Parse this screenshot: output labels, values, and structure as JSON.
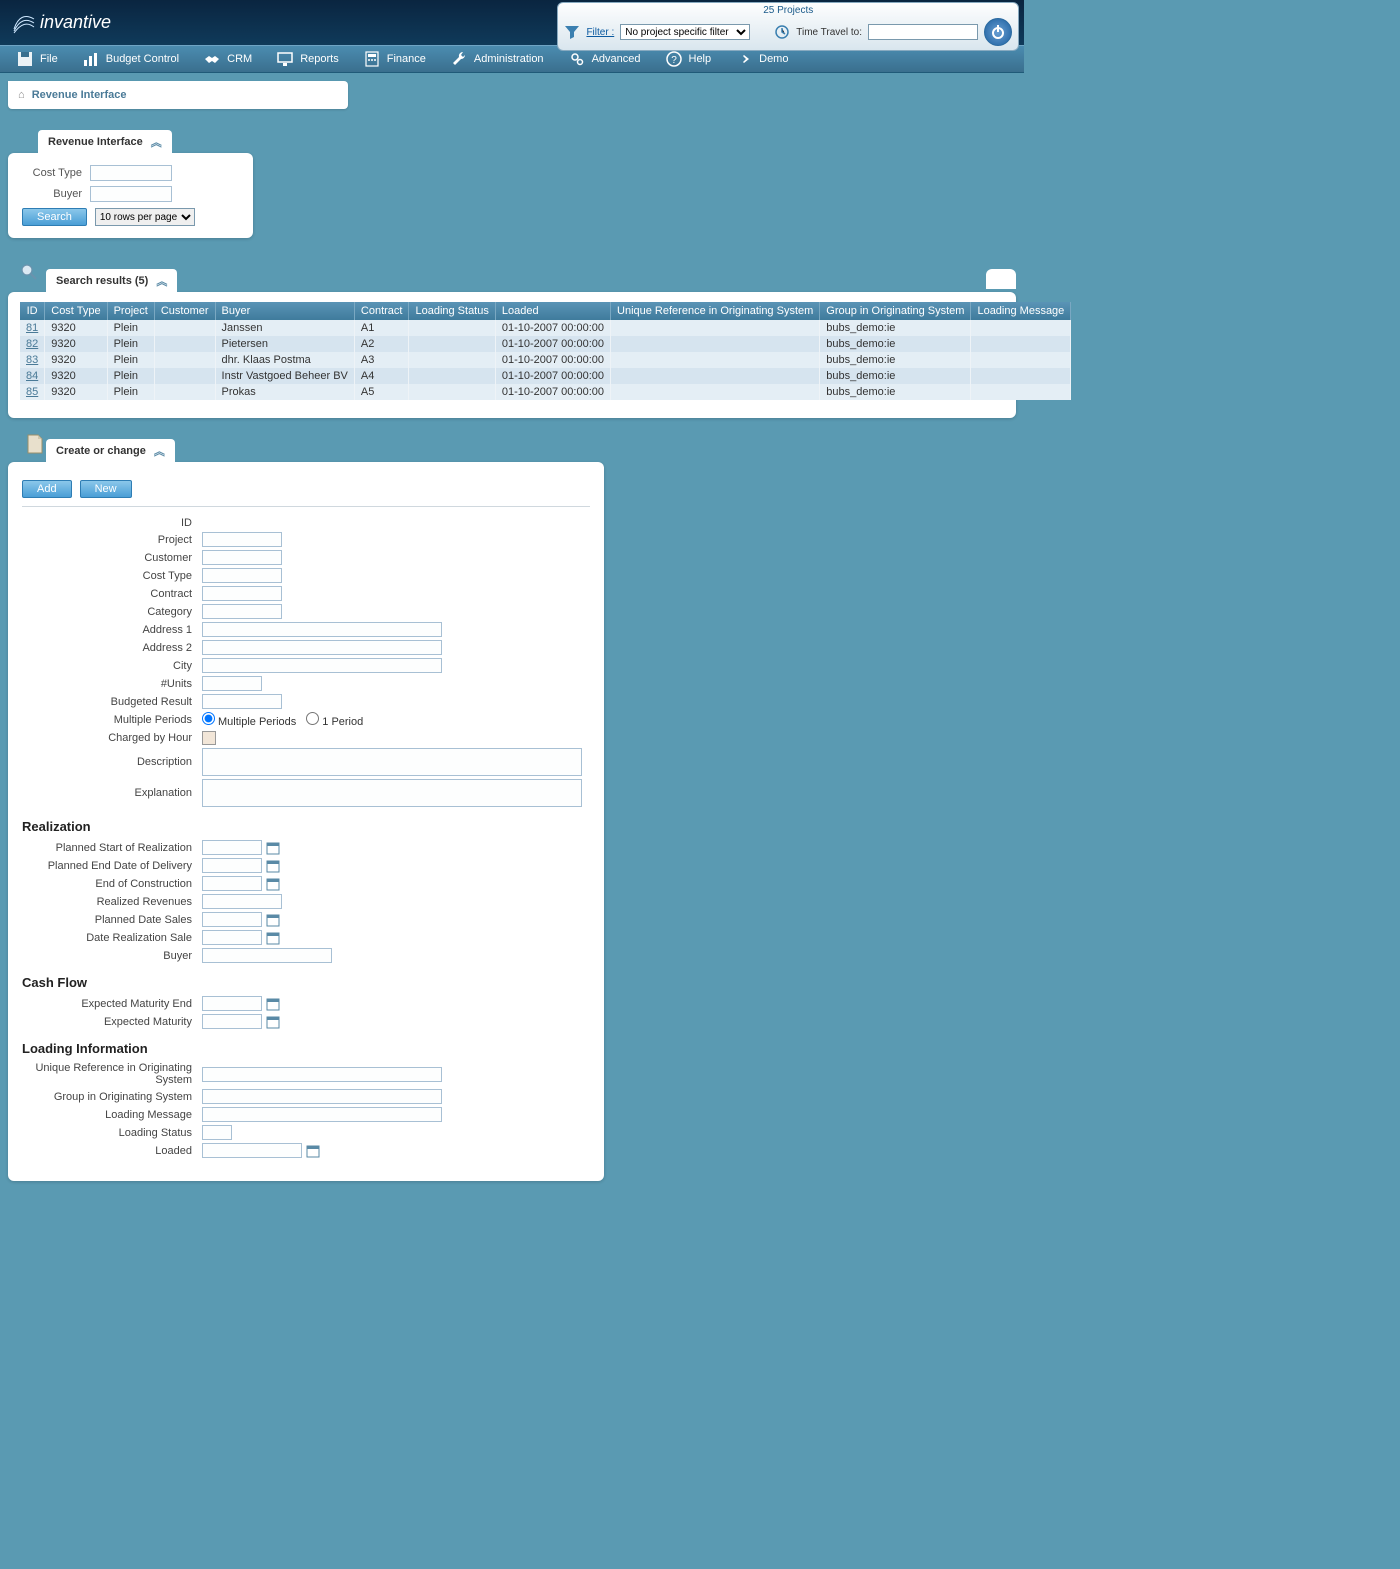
{
  "header": {
    "brand": "invantive",
    "projects_count": "25 Projects",
    "filter_label": "Filter :",
    "filter_value": "No project specific filter",
    "time_travel_label": "Time Travel to:",
    "time_travel_value": ""
  },
  "nav": {
    "items": [
      {
        "label": "File",
        "icon": "disk-icon"
      },
      {
        "label": "Budget Control",
        "icon": "chart-icon"
      },
      {
        "label": "CRM",
        "icon": "handshake-icon"
      },
      {
        "label": "Reports",
        "icon": "monitor-icon"
      },
      {
        "label": "Finance",
        "icon": "calculator-icon"
      },
      {
        "label": "Administration",
        "icon": "wrench-icon"
      },
      {
        "label": "Advanced",
        "icon": "gears-icon"
      },
      {
        "label": "Help",
        "icon": "question-icon"
      },
      {
        "label": "Demo",
        "icon": "arrow-icon"
      }
    ]
  },
  "breadcrumb": {
    "page": "Revenue Interface"
  },
  "search_panel": {
    "title": "Revenue Interface",
    "cost_type_label": "Cost Type",
    "cost_type_value": "",
    "buyer_label": "Buyer",
    "buyer_value": "",
    "search_btn": "Search",
    "rows_per_page": "10 rows per page"
  },
  "results": {
    "title": "Search results (5)",
    "columns": [
      "ID",
      "Cost Type",
      "Project",
      "Customer",
      "Buyer",
      "Contract",
      "Loading Status",
      "Loaded",
      "Unique Reference in Originating System",
      "Group in Originating System",
      "Loading Message"
    ],
    "rows": [
      {
        "id": "81",
        "cost_type": "9320",
        "project": "Plein",
        "customer": "",
        "buyer": "Janssen",
        "contract": "A1",
        "loading_status": "",
        "loaded": "01-10-2007 00:00:00",
        "uref": "",
        "group": "bubs_demo:ie",
        "msg": ""
      },
      {
        "id": "82",
        "cost_type": "9320",
        "project": "Plein",
        "customer": "",
        "buyer": "Pietersen",
        "contract": "A2",
        "loading_status": "",
        "loaded": "01-10-2007 00:00:00",
        "uref": "",
        "group": "bubs_demo:ie",
        "msg": ""
      },
      {
        "id": "83",
        "cost_type": "9320",
        "project": "Plein",
        "customer": "",
        "buyer": "dhr. Klaas Postma",
        "contract": "A3",
        "loading_status": "",
        "loaded": "01-10-2007 00:00:00",
        "uref": "",
        "group": "bubs_demo:ie",
        "msg": ""
      },
      {
        "id": "84",
        "cost_type": "9320",
        "project": "Plein",
        "customer": "",
        "buyer": "Instr Vastgoed Beheer BV",
        "contract": "A4",
        "loading_status": "",
        "loaded": "01-10-2007 00:00:00",
        "uref": "",
        "group": "bubs_demo:ie",
        "msg": ""
      },
      {
        "id": "85",
        "cost_type": "9320",
        "project": "Plein",
        "customer": "",
        "buyer": "Prokas",
        "contract": "A5",
        "loading_status": "",
        "loaded": "01-10-2007 00:00:00",
        "uref": "",
        "group": "bubs_demo:ie",
        "msg": ""
      }
    ]
  },
  "create_change": {
    "title": "Create or change",
    "add_btn": "Add",
    "new_btn": "New",
    "fields": {
      "id": "ID",
      "project": "Project",
      "customer": "Customer",
      "cost_type": "Cost Type",
      "contract": "Contract",
      "category": "Category",
      "address1": "Address 1",
      "address2": "Address 2",
      "city": "City",
      "units": "#Units",
      "budgeted_result": "Budgeted Result",
      "multiple_periods": "Multiple Periods",
      "mp_opt1": "Multiple Periods",
      "mp_opt2": "1 Period",
      "charged_by_hour": "Charged by Hour",
      "description": "Description",
      "explanation": "Explanation"
    },
    "realization": {
      "heading": "Realization",
      "planned_start": "Planned Start of Realization",
      "planned_end": "Planned End Date of Delivery",
      "end_construction": "End of Construction",
      "realized_revenues": "Realized Revenues",
      "planned_date_sales": "Planned Date Sales",
      "date_realization_sale": "Date Realization Sale",
      "buyer": "Buyer"
    },
    "cash_flow": {
      "heading": "Cash Flow",
      "expected_maturity_end": "Expected Maturity End",
      "expected_maturity": "Expected Maturity"
    },
    "loading": {
      "heading": "Loading Information",
      "uref": "Unique Reference in Originating System",
      "group": "Group in Originating System",
      "message": "Loading Message",
      "status": "Loading Status",
      "loaded": "Loaded"
    }
  }
}
